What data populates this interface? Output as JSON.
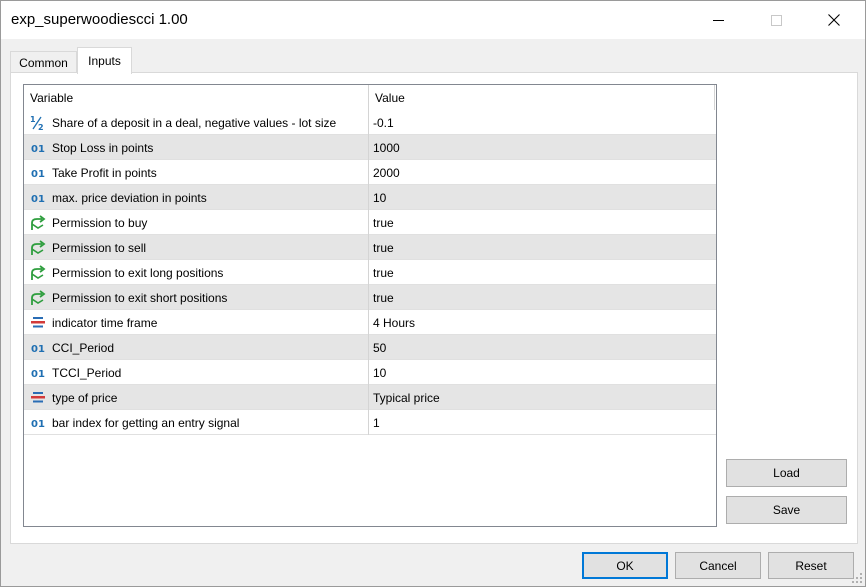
{
  "window": {
    "title": "exp_superwoodiescci 1.00"
  },
  "tabs": [
    {
      "label": "Common"
    },
    {
      "label": "Inputs"
    }
  ],
  "grid": {
    "columns": {
      "variable": "Variable",
      "value": "Value"
    },
    "rows": [
      {
        "icon": "fraction-icon",
        "variable": "Share of a deposit in a deal, negative values - lot size",
        "value": "-0.1"
      },
      {
        "icon": "integer-icon",
        "variable": "Stop Loss in points",
        "value": "1000"
      },
      {
        "icon": "integer-icon",
        "variable": "Take Profit in points",
        "value": "2000"
      },
      {
        "icon": "integer-icon",
        "variable": "max. price deviation in points",
        "value": "10"
      },
      {
        "icon": "boolean-icon",
        "variable": "Permission to buy",
        "value": "true"
      },
      {
        "icon": "boolean-icon",
        "variable": "Permission to sell",
        "value": "true"
      },
      {
        "icon": "boolean-icon",
        "variable": "Permission to exit long positions",
        "value": "true"
      },
      {
        "icon": "boolean-icon",
        "variable": "Permission to exit short positions",
        "value": "true"
      },
      {
        "icon": "enum-icon",
        "variable": "indicator time frame",
        "value": "4 Hours"
      },
      {
        "icon": "integer-icon",
        "variable": "CCI_Period",
        "value": "50"
      },
      {
        "icon": "integer-icon",
        "variable": "TCCI_Period",
        "value": "10"
      },
      {
        "icon": "enum-icon",
        "variable": "type of price",
        "value": "Typical price"
      },
      {
        "icon": "integer-icon",
        "variable": "bar index for getting an entry signal",
        "value": "1"
      }
    ]
  },
  "buttons": {
    "load": "Load",
    "save": "Save",
    "ok": "OK",
    "cancel": "Cancel",
    "reset": "Reset"
  },
  "colors": {
    "integer_icon": "#1f6fb2",
    "boolean_icon": "#2e9e3e",
    "enum_icon_red": "#d23a3a",
    "enum_icon_blue": "#2a6db5",
    "alt_row": "#e5e5e5",
    "focus_border": "#0078d7"
  }
}
